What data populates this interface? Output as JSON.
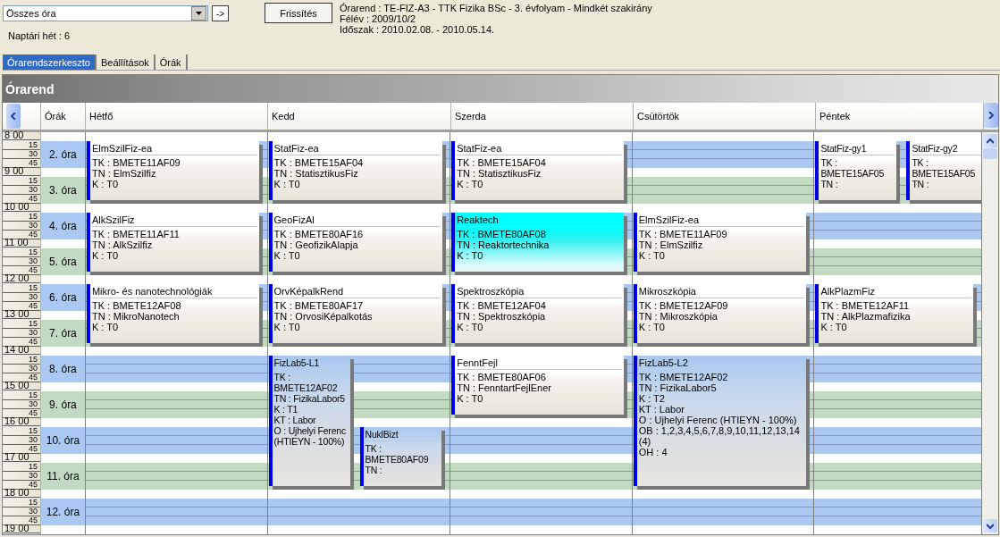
{
  "filter": {
    "value": "Összes óra",
    "go_button": "->"
  },
  "refresh_button": "Frissítés",
  "week": "Naptári hét : 6",
  "info": [
    "Órarend : TE-FIZ-A3 - TTK Fizika BSc - 3. évfolyam - Mindkét szakirány",
    "Félév : 2009/10/2",
    "Időszak : 2010.02.08. - 2010.05.14."
  ],
  "tabs": [
    {
      "label": "Órarendszerkeszto",
      "selected": true
    },
    {
      "label": "Beállítások",
      "selected": false
    },
    {
      "label": "Órák",
      "selected": false
    }
  ],
  "banner": "Órarend",
  "periods_header": "Órák",
  "time_ruler": [
    "8 00",
    "15",
    "30",
    "45",
    "9 00",
    "15",
    "30",
    "45",
    "10 00",
    "15",
    "30",
    "45",
    "11 00",
    "15",
    "30",
    "45",
    "12 00",
    "15",
    "30",
    "45",
    "13 00",
    "15",
    "30",
    "45",
    "14 00",
    "15",
    "30",
    "45",
    "15 00",
    "15",
    "30",
    "45",
    "16 00",
    "15",
    "30",
    "45",
    "17 00",
    "15",
    "30",
    "45",
    "18 00",
    "15",
    "30",
    "45",
    "19 00"
  ],
  "periods": [
    {
      "label": "2. óra"
    },
    {
      "label": "3. óra"
    },
    {
      "label": "4. óra"
    },
    {
      "label": "5. óra"
    },
    {
      "label": "6. óra"
    },
    {
      "label": "7. óra"
    },
    {
      "label": "8. óra"
    },
    {
      "label": "9. óra"
    },
    {
      "label": "10. óra"
    },
    {
      "label": "11. óra"
    },
    {
      "label": "12. óra"
    }
  ],
  "days": [
    {
      "name": "Hétfő",
      "events": [
        {
          "title": "ElmSzilFiz-ea",
          "lines": [
            "TK : BMETE11AF09",
            "TN : ElmSzilfiz",
            "K : T0"
          ],
          "kind": "lecture",
          "selected": false
        },
        {
          "title": "AlkSzilFiz",
          "lines": [
            "TK : BMETE11AF11",
            "TN : AlkSzilfiz",
            "K : T0"
          ],
          "kind": "lecture",
          "selected": false
        },
        {
          "title": "Mikro- és nanotechnológiák",
          "lines": [
            "TK : BMETE12AF08",
            "TN : MikroNanotech",
            "K : T0"
          ],
          "kind": "lecture",
          "selected": false
        }
      ]
    },
    {
      "name": "Kedd",
      "events": [
        {
          "title": "StatFiz-ea",
          "lines": [
            "TK : BMETE15AF04",
            "TN : StatisztikusFiz",
            "K : T0"
          ],
          "kind": "lecture",
          "selected": false
        },
        {
          "title": "GeoFizAl",
          "lines": [
            "TK : BMETE80AF16",
            "TN : GeofizikAlapja",
            "K : T0"
          ],
          "kind": "lecture",
          "selected": false
        },
        {
          "title": "OrvKépalkRend",
          "lines": [
            "TK : BMETE80AF17",
            "TN : OrvosiKépalkotás",
            "K : T0"
          ],
          "kind": "lecture",
          "selected": false
        },
        {
          "title": "FizLab5-L1",
          "lines": [
            "TK : BMETE12AF02",
            "TN : FizikaLabor5",
            "K : T1",
            "KT : Labor",
            "O : Ujhelyi Ferenc (HTIEYN - 100%)"
          ],
          "kind": "lab",
          "selected": false
        },
        {
          "title": "NuklBizt",
          "lines": [
            "TK : BMETE80AF09",
            "TN :"
          ],
          "kind": "lab",
          "selected": false
        }
      ]
    },
    {
      "name": "Szerda",
      "events": [
        {
          "title": "StatFiz-ea",
          "lines": [
            "TK : BMETE15AF04",
            "TN : StatisztikusFiz",
            "K : T0"
          ],
          "kind": "lecture",
          "selected": false
        },
        {
          "title": "Reaktech",
          "lines": [
            "TK : BMETE80AF08",
            "TN : Reaktortechnika",
            "K : T0"
          ],
          "kind": "lecture",
          "selected": true
        },
        {
          "title": "Spektroszkópia",
          "lines": [
            "TK : BMETE12AF04",
            "TN : Spektroszkópia",
            "K : T0"
          ],
          "kind": "lecture",
          "selected": false
        },
        {
          "title": "FenntFejl",
          "lines": [
            "TK : BMETE80AF06",
            "TN : FenntartFejlEner",
            "K : T0"
          ],
          "kind": "lecture",
          "selected": false
        }
      ]
    },
    {
      "name": "Csütörtök",
      "events": [
        {
          "title": "ElmSzilFiz-ea",
          "lines": [
            "TK : BMETE11AF09",
            "TN : ElmSzilfiz",
            "K : T0"
          ],
          "kind": "lecture",
          "selected": false
        },
        {
          "title": "Mikroszkópia",
          "lines": [
            "TK : BMETE12AF09",
            "TN : Mikroszkópia",
            "K : T0"
          ],
          "kind": "lecture",
          "selected": false
        },
        {
          "title": "FizLab5-L2",
          "lines": [
            "TK : BMETE12AF02",
            "TN : FizikaLabor5",
            "K : T2",
            "KT : Labor",
            "O : Ujhelyi Ferenc (HTIEYN - 100%)",
            "OB : 1,2,3,4,5,6,7,8,9,10,11,12,13,14 (4)",
            "OH : 4"
          ],
          "kind": "lab",
          "selected": false
        }
      ]
    },
    {
      "name": "Péntek",
      "events": [
        {
          "title": "StatFiz-gy1",
          "lines": [
            "TK : BMETE15AF05",
            "TN :"
          ],
          "kind": "lecture",
          "selected": false
        },
        {
          "title": "StatFiz-gy2",
          "lines": [
            "TK : BMETE15AF05",
            "TN :"
          ],
          "kind": "lecture",
          "selected": false
        },
        {
          "title": "AlkPlazmFiz",
          "lines": [
            "TK : BMETE12AF11",
            "TN : AlkPlazmafizika",
            "K : T0"
          ],
          "kind": "lecture",
          "selected": false
        }
      ]
    }
  ]
}
